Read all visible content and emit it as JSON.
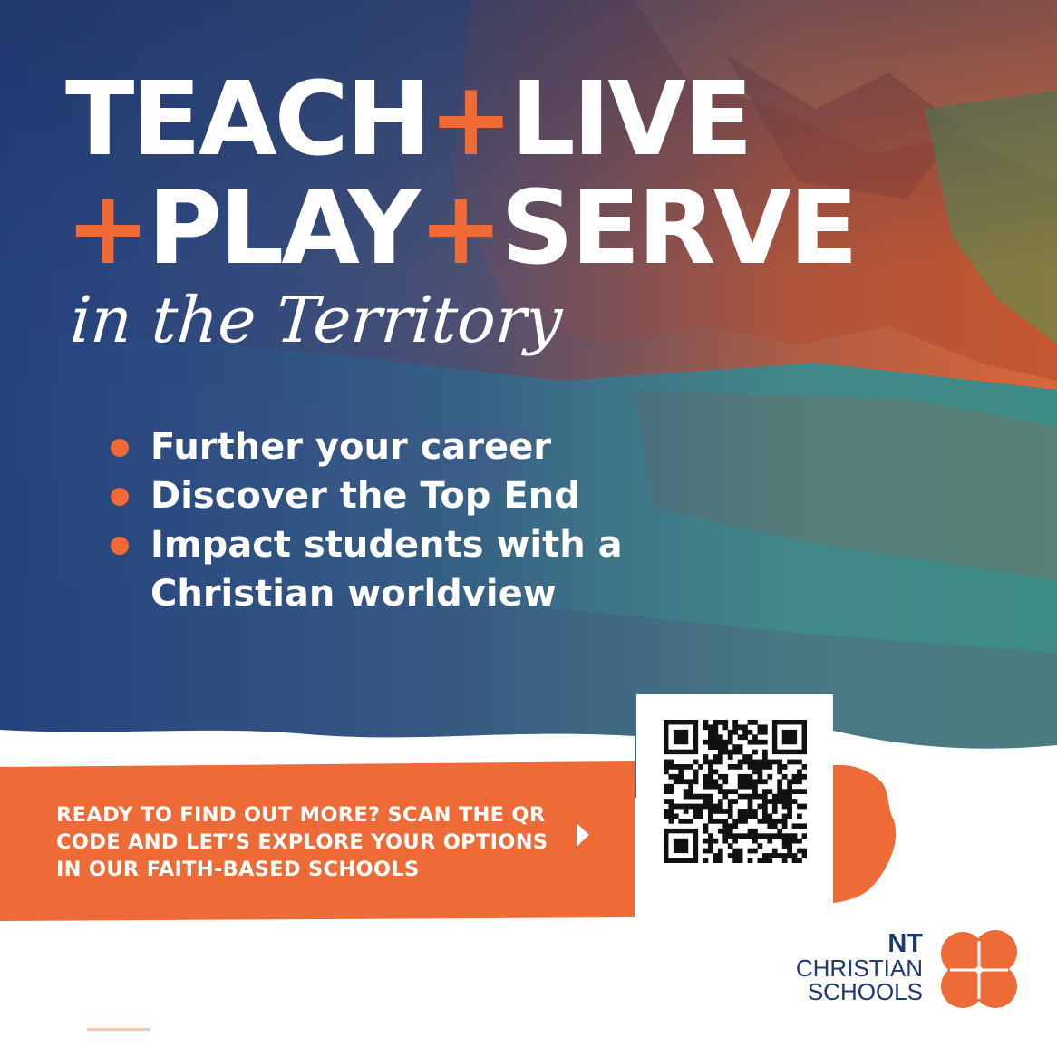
{
  "headline": {
    "line1": [
      "TEACH",
      "+",
      "LIVE"
    ],
    "line2": [
      "+",
      "PLAY",
      "+",
      "SERVE"
    ]
  },
  "tagline": "in the Territory",
  "benefits": [
    "Further your career",
    "Discover the Top End",
    "Impact students with a Christian worldview"
  ],
  "cta": {
    "lines": [
      "READY TO FIND OUT MORE? SCAN THE QR",
      "CODE AND LET’S EXPLORE YOUR OPTIONS",
      "IN OUR FAITH-BASED SCHOOLS"
    ],
    "arrow_icon": "triangle-right-icon"
  },
  "qr_icon": "qr-code-icon",
  "brand": {
    "line1": "NT",
    "line2": "CHRISTIAN",
    "line3": "SCHOOLS",
    "logo_icon": "four-petal-flower-icon"
  },
  "colors": {
    "accent": "#f06a36",
    "navy": "#1d3a6e",
    "deep_blue": "#25407a",
    "water": "#3f8f8a",
    "rock": "#c5562f"
  }
}
